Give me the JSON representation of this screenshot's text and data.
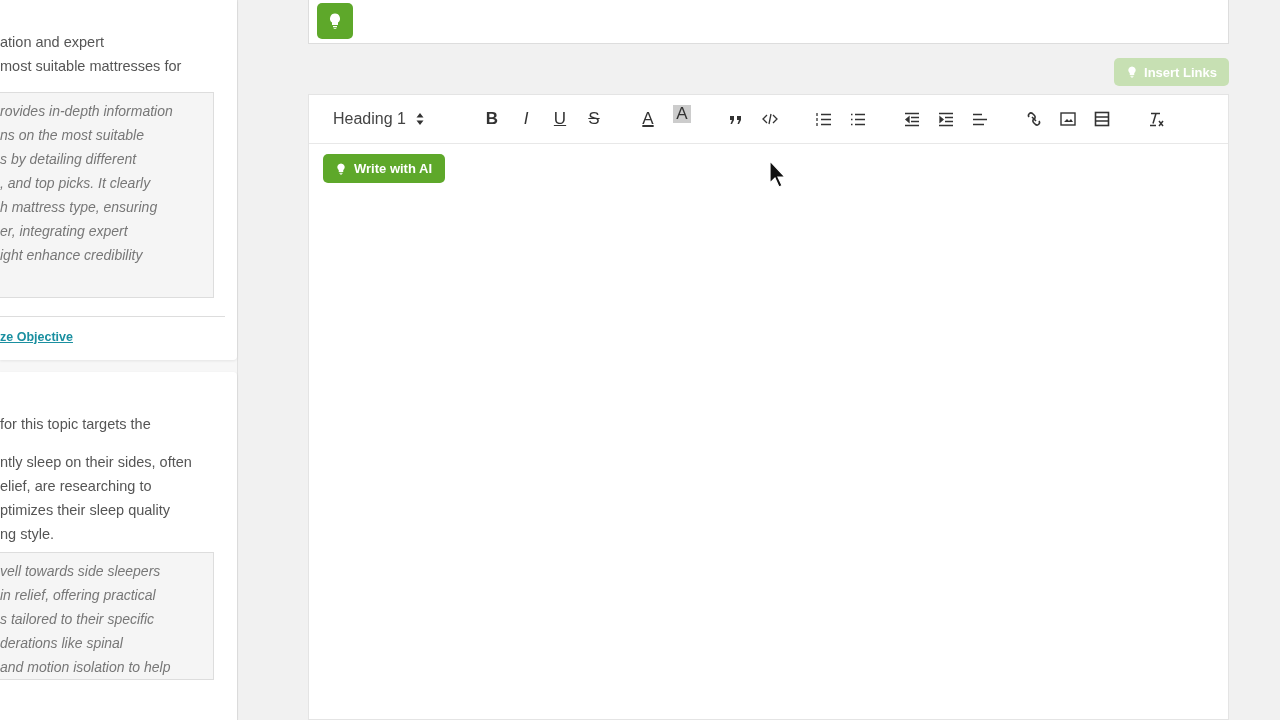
{
  "left_panel": {
    "cards": [
      {
        "paragraphs": [
          [
            "ation and expert",
            "most suitable mattresses for"
          ]
        ],
        "quote_lines": [
          "rovides in-depth information",
          "ns on the most suitable",
          "s by detailing different",
          ", and top picks. It clearly",
          "h mattress type, ensuring",
          "er, integrating expert",
          "ight enhance credibility"
        ],
        "link": "ze Objective"
      },
      {
        "paragraphs": [
          [
            "for this topic targets the"
          ],
          [
            "ntly sleep on their sides, often",
            "elief, are researching to",
            "ptimizes their sleep quality",
            "ng style."
          ]
        ],
        "quote_lines": [
          "vell towards side sleepers",
          "in relief, offering practical",
          "s tailored to their specific",
          "derations like spinal",
          "and motion isolation to help"
        ]
      }
    ]
  },
  "editor": {
    "insert_links": {
      "label": "Insert Links",
      "disabled": true
    },
    "toolbar": {
      "heading_select": {
        "value": "Heading 1"
      },
      "text_tools": [
        "B",
        "I",
        "U",
        "S",
        "A",
        "A"
      ]
    },
    "write_ai": {
      "label": "Write with AI"
    }
  }
}
